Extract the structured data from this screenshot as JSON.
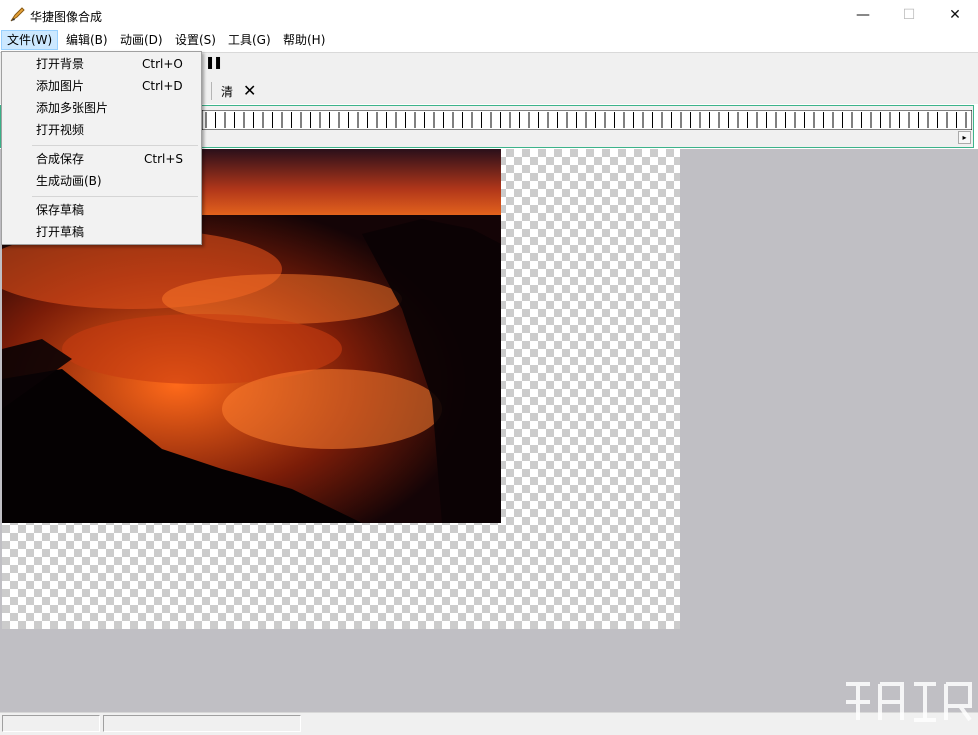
{
  "window": {
    "title": "华捷图像合成",
    "minimize": "—",
    "maximize": "☐",
    "close": "✕"
  },
  "menubar": {
    "items": [
      {
        "label": "文件(W)"
      },
      {
        "label": "编辑(B)"
      },
      {
        "label": "动画(D)"
      },
      {
        "label": "设置(S)"
      },
      {
        "label": "工具(G)"
      },
      {
        "label": "帮助(H)"
      }
    ]
  },
  "toolbar": {
    "pause_glyph": "❚❚",
    "clear_label": "清",
    "close_glyph": "✕"
  },
  "file_menu": {
    "items": [
      {
        "label": "打开背景",
        "shortcut": "Ctrl+O"
      },
      {
        "label": "添加图片",
        "shortcut": "Ctrl+D"
      },
      {
        "label": "添加多张图片",
        "shortcut": ""
      },
      {
        "label": "打开视频",
        "shortcut": ""
      },
      {
        "label": "合成保存",
        "shortcut": "Ctrl+S"
      },
      {
        "label": "生成动画(B)",
        "shortcut": ""
      },
      {
        "label": "保存草稿",
        "shortcut": ""
      },
      {
        "label": "打开草稿",
        "shortcut": ""
      }
    ]
  },
  "colors": {
    "menu_highlight": "#cce8ff",
    "timeline_border": "#3cb38a",
    "workspace": "#c0bfc4"
  }
}
